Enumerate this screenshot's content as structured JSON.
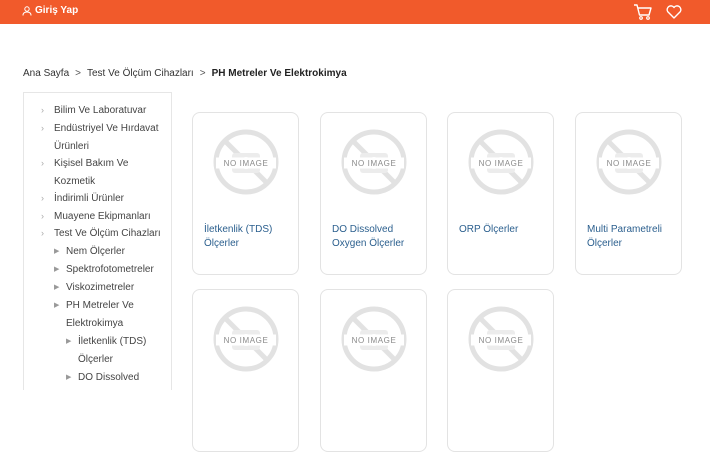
{
  "header": {
    "login_label": "Giriş Yap",
    "accent_color": "#f15a2b",
    "icons": [
      "user-icon",
      "cart-icon",
      "heart-icon"
    ]
  },
  "breadcrumb": {
    "items": [
      "Ana Sayfa",
      "Test Ve Ölçüm Cihazları"
    ],
    "current": "PH Metreler Ve Elektrokimya"
  },
  "sidebar": {
    "categories": [
      {
        "label_lines": [
          "Bilim Ve Laboratuvar"
        ]
      },
      {
        "label_lines": [
          "Endüstriyel Ve Hırdavat",
          "Ürünleri"
        ]
      },
      {
        "label_lines": [
          "Kişisel Bakım Ve",
          "Kozmetik"
        ]
      },
      {
        "label_lines": [
          "İndirimli Ürünler"
        ]
      },
      {
        "label_lines": [
          "Muayene Ekipmanları"
        ]
      },
      {
        "label_lines": [
          "Test Ve Ölçüm Cihazları"
        ]
      }
    ],
    "subcategories": [
      {
        "label_lines": [
          "Nem Ölçerler"
        ]
      },
      {
        "label_lines": [
          "Spektrofotometreler"
        ]
      },
      {
        "label_lines": [
          "Viskozimetreler"
        ]
      },
      {
        "label_lines": [
          "PH Metreler Ve",
          "Elektrokimya"
        ]
      }
    ],
    "subsubcategories": [
      {
        "label_lines": [
          "İletkenlik (TDS)",
          "Ölçerler"
        ]
      },
      {
        "label_lines": [
          "DO Dissolved"
        ]
      }
    ]
  },
  "products": {
    "no_image_text": "NO IMAGE",
    "items": [
      {
        "title": "İletkenlik (TDS) Ölçerler"
      },
      {
        "title": "DO Dissolved Oxygen Ölçerler"
      },
      {
        "title": "ORP Ölçerler"
      },
      {
        "title": "Multi Parametreli Ölçerler"
      },
      {
        "title": ""
      },
      {
        "title": ""
      },
      {
        "title": ""
      }
    ]
  }
}
